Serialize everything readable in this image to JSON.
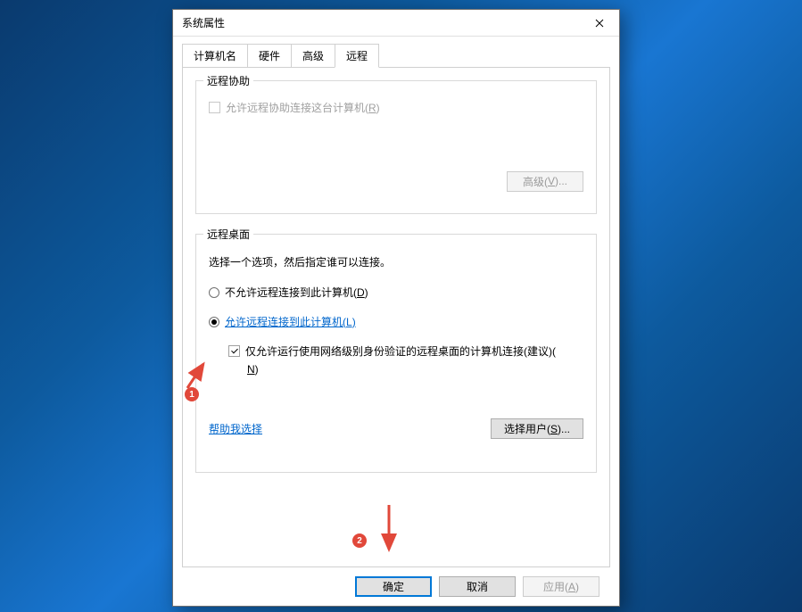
{
  "title": "系统属性",
  "tabs": {
    "computer_name": "计算机名",
    "hardware": "硬件",
    "advanced": "高级",
    "remote": "远程"
  },
  "remote_assist": {
    "group_title": "远程协助",
    "checkbox_text": "允许远程协助连接这台计算机(",
    "checkbox_hotkey": "R",
    "checkbox_suffix": ")",
    "advanced_btn_prefix": "高级(",
    "advanced_btn_hotkey": "V",
    "advanced_btn_suffix": ")..."
  },
  "remote_desktop": {
    "group_title": "远程桌面",
    "instruction": "选择一个选项，然后指定谁可以连接。",
    "radio_deny_prefix": "不允许远程连接到此计算机(",
    "radio_deny_hotkey": "D",
    "radio_deny_suffix": ")",
    "radio_allow_prefix": "允许远程连接到此计算机(",
    "radio_allow_hotkey": "L",
    "radio_allow_suffix": ")",
    "nla_text": "仅允许运行使用网络级别身份验证的远程桌面的计算机连接(建议)(",
    "nla_hotkey": "N",
    "nla_suffix": ")",
    "help_link": "帮助我选择",
    "select_users_prefix": "选择用户(",
    "select_users_hotkey": "S",
    "select_users_suffix": ")..."
  },
  "buttons": {
    "ok": "确定",
    "cancel": "取消",
    "apply_prefix": "应用(",
    "apply_hotkey": "A",
    "apply_suffix": ")"
  },
  "annotations": {
    "badge1": "1",
    "badge2": "2"
  }
}
